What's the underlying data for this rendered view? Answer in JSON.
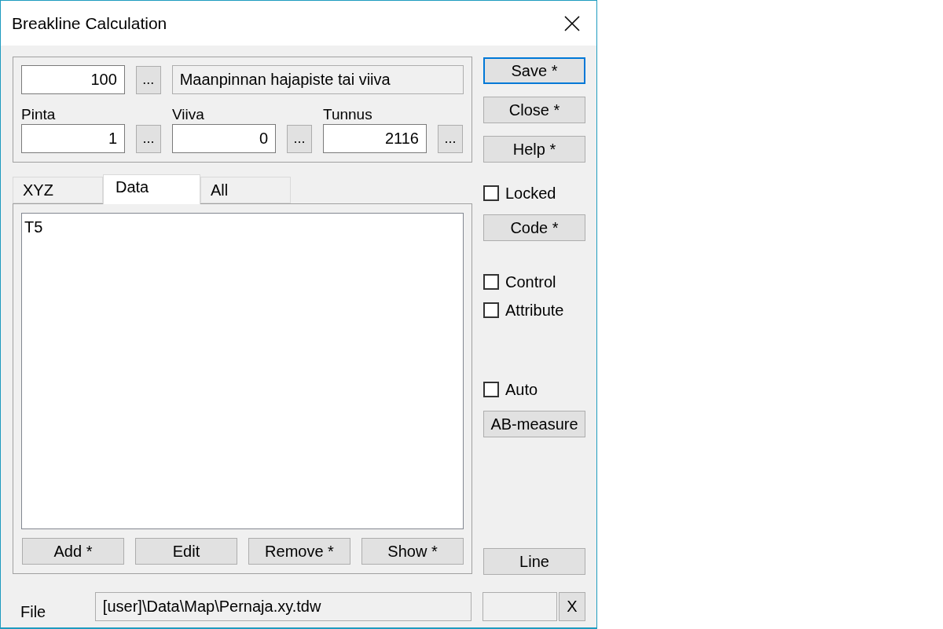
{
  "window": {
    "title": "Breakline Calculation"
  },
  "header": {
    "code": "100",
    "code_button": "...",
    "description": "Maanpinnan hajapiste tai viiva"
  },
  "fields": [
    {
      "label": "Pinta",
      "value": "1",
      "button": "..."
    },
    {
      "label": "Viiva",
      "value": "0",
      "button": "..."
    },
    {
      "label": "Tunnus",
      "value": "2116",
      "button": "..."
    }
  ],
  "tabs": [
    {
      "label": "XYZ",
      "selected": false
    },
    {
      "label": "Data",
      "selected": true
    },
    {
      "label": "All",
      "selected": false
    }
  ],
  "list": {
    "items": [
      "T5"
    ]
  },
  "list_buttons": [
    "Add *",
    "Edit",
    "Remove *",
    "Show *"
  ],
  "file": {
    "label": "File",
    "value": "[user]\\Data\\Map\\Pernaja.xy.tdw",
    "clear_button": "X"
  },
  "side": [
    {
      "kind": "button",
      "label": "Save *",
      "focused": true
    },
    {
      "kind": "button",
      "label": "Close *",
      "focused": false
    },
    {
      "kind": "button",
      "label": "Help *",
      "focused": false
    },
    {
      "kind": "checkbox",
      "label": "Locked",
      "checked": false
    },
    {
      "kind": "button",
      "label": "Code *",
      "focused": false
    },
    {
      "kind": "checkbox",
      "label": "Control",
      "checked": false
    },
    {
      "kind": "checkbox",
      "label": "Attribute",
      "checked": false
    },
    {
      "kind": "checkbox",
      "label": "Auto",
      "checked": false
    },
    {
      "kind": "button",
      "label": "AB-measure",
      "focused": false
    },
    {
      "kind": "button",
      "label": "Line",
      "focused": false
    }
  ]
}
